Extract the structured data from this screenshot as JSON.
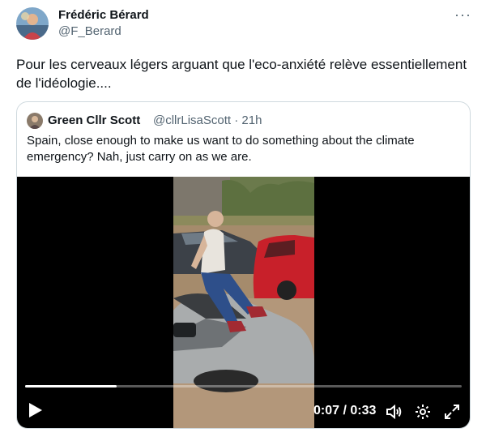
{
  "author": {
    "name": "Frédéric Bérard",
    "handle": "@F_Berard",
    "more_label": "···"
  },
  "tweet": {
    "text": "Pour les cerveaux légers arguant que l'eco-anxiété relève essentiellement de l'idéologie...."
  },
  "quoted": {
    "name": "Green Cllr Scott",
    "handle_time": "@cllrLisaScott · 21h",
    "text": "Spain, close enough to make us want to do something about the climate emergency? Nah, just carry on as we are."
  },
  "video": {
    "time": "0:07 / 0:33",
    "progress": 0.21,
    "controls": [
      "play-icon",
      "volume-icon",
      "settings-icon",
      "fullscreen-icon"
    ]
  },
  "colors": {
    "text": "#0f1419",
    "secondary": "#536471",
    "border": "#cfd9de",
    "video_bg": "#000000"
  }
}
